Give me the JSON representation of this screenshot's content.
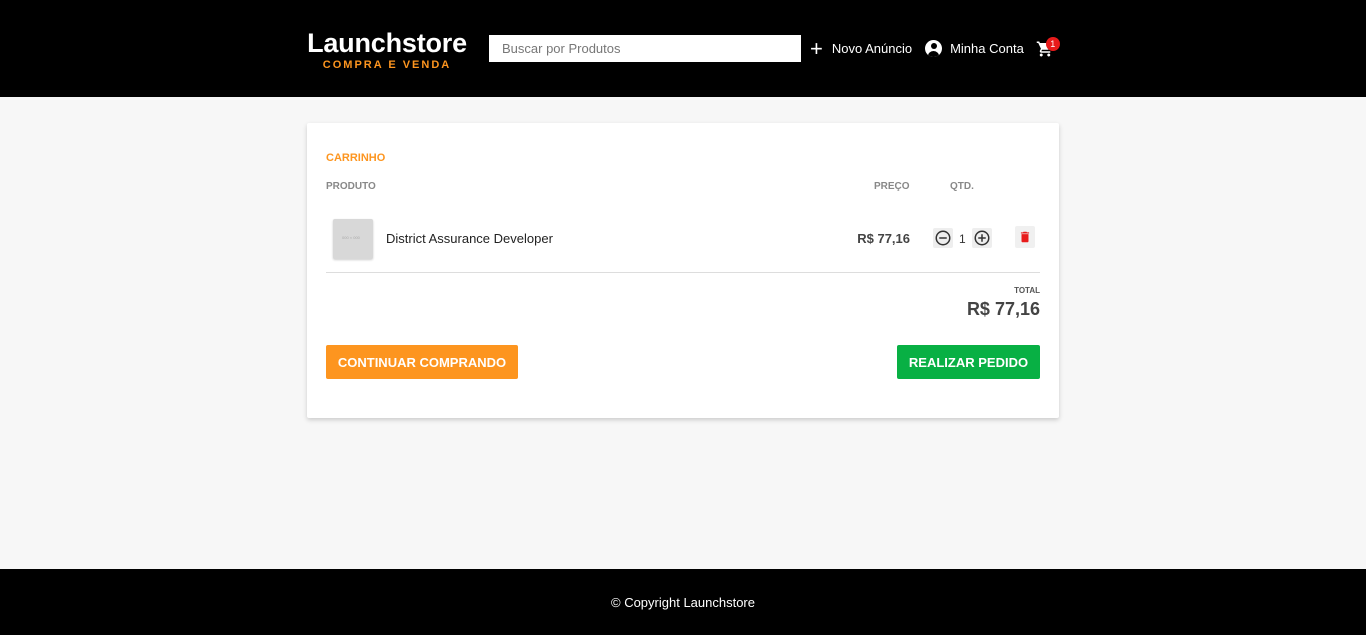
{
  "header": {
    "logo_title": "Launchstore",
    "logo_subtitle": "COMPRA E VENDA",
    "search_placeholder": "Buscar por Produtos",
    "new_ad_label": "Novo Anúncio",
    "account_label": "Minha Conta",
    "cart_count": "1",
    "icons": {
      "new_ad": "plus-icon",
      "account": "account-circle-icon",
      "cart": "shopping-cart-icon"
    }
  },
  "cart": {
    "title": "CARRINHO",
    "columns": {
      "product": "PRODUTO",
      "price": "PREÇO",
      "quantity": "QTD."
    },
    "items": [
      {
        "name": "District Assurance Developer",
        "price": "R$ 77,16",
        "quantity": "1",
        "thumbnail_text": "000 × 000"
      }
    ],
    "total_label": "TOTAL",
    "total_value": "R$ 77,16",
    "continue_label": "CONTINUAR COMPRANDO",
    "order_label": "REALIZAR PEDIDO"
  },
  "footer": {
    "copyright": "© Copyright Launchstore"
  },
  "colors": {
    "accent": "#fd951f",
    "success": "#08b044",
    "danger": "#e81b1b",
    "header_bg": "#000000"
  }
}
